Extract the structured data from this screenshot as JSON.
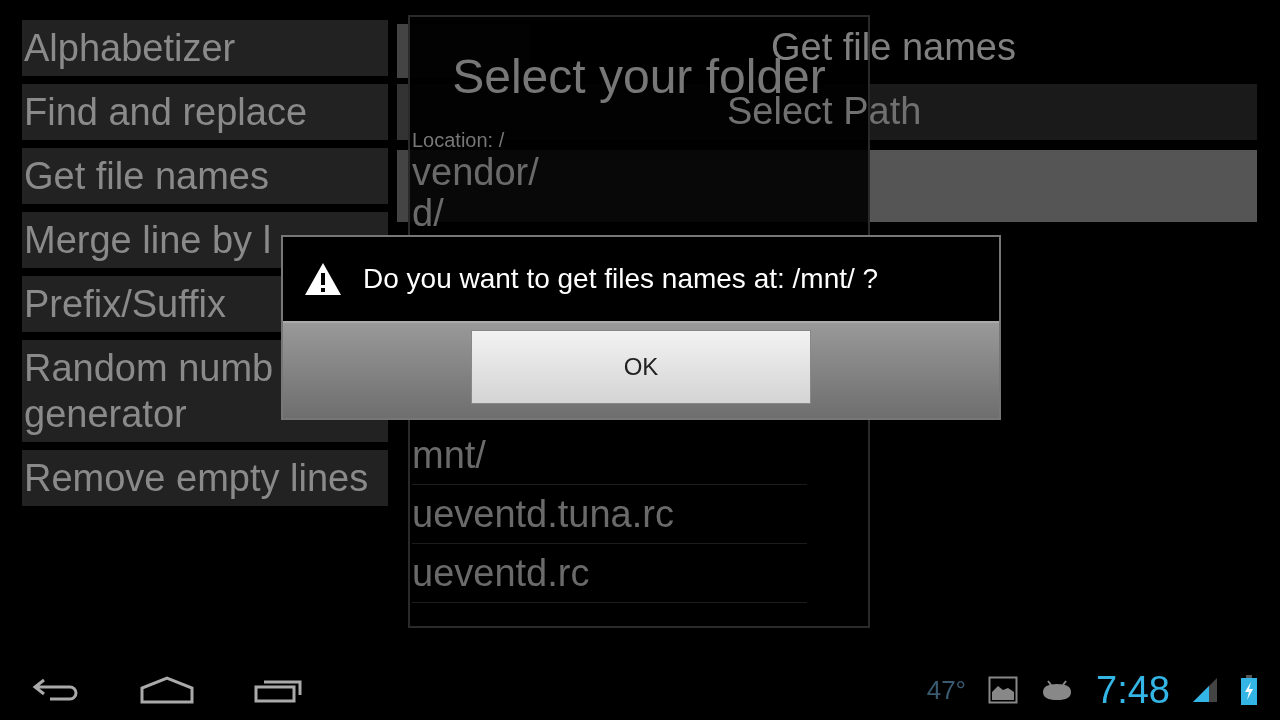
{
  "sidebar": {
    "items": [
      {
        "lines": [
          "Alphabetizer"
        ]
      },
      {
        "lines": [
          "Find and replace"
        ]
      },
      {
        "lines": [
          "Get file names"
        ]
      },
      {
        "lines": [
          "Merge line by l"
        ]
      },
      {
        "lines": [
          "Prefix/Suffix"
        ]
      },
      {
        "lines": [
          "Random numb",
          "generator"
        ]
      },
      {
        "lines": [
          "Remove empty lines"
        ]
      }
    ]
  },
  "main": {
    "heading": "Get file names",
    "select_path_button": "Select Path"
  },
  "folder_dialog": {
    "title": "Select your folder",
    "location": "Location: /",
    "items_above": [
      "vendor/",
      "d/"
    ],
    "items_below": [
      "mnt/",
      "ueventd.tuna.rc",
      "ueventd.rc"
    ]
  },
  "alert": {
    "message": "Do you want to get files names at: /mnt/ ?",
    "button": "OK"
  },
  "status_bar": {
    "temperature": "47°",
    "time": "7:48"
  }
}
